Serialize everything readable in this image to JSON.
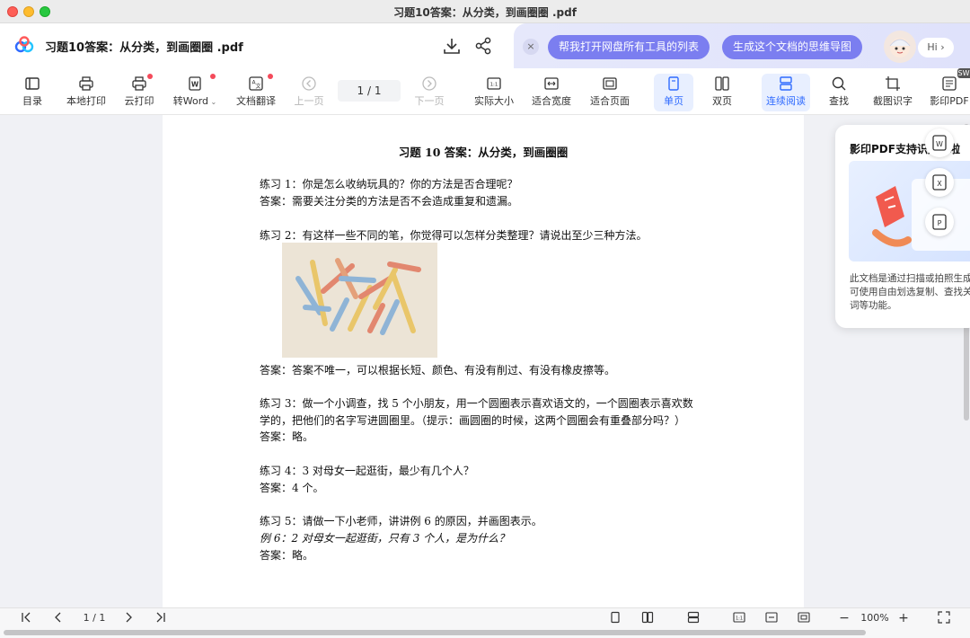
{
  "window": {
    "title": "习题10答案：从分类，到画圈圈 .pdf"
  },
  "header": {
    "doc_title": "习题10答案：从分类，到画圈圈 .pdf",
    "ai_chips": [
      "帮我打开网盘所有工具的列表",
      "生成这个文档的思维导图"
    ],
    "ai_hi": "Hi",
    "close_glyph": "×"
  },
  "toolbar": {
    "items": [
      {
        "label": "目录",
        "icon": "toc-icon"
      },
      {
        "label": "本地打印",
        "icon": "printer-icon"
      },
      {
        "label": "云打印",
        "icon": "cloud-print-icon"
      },
      {
        "label": "转Word",
        "icon": "word-icon"
      },
      {
        "label": "文档翻译",
        "icon": "translate-icon"
      },
      {
        "label": "上一页",
        "icon": "prev-page-icon"
      },
      {
        "label": "下一页",
        "icon": "next-page-icon"
      },
      {
        "label": "实际大小",
        "icon": "actual-size-icon"
      },
      {
        "label": "适合宽度",
        "icon": "fit-width-icon"
      },
      {
        "label": "适合页面",
        "icon": "fit-page-icon"
      },
      {
        "label": "单页",
        "icon": "single-page-icon"
      },
      {
        "label": "双页",
        "icon": "double-page-icon"
      },
      {
        "label": "连续阅读",
        "icon": "continuous-icon"
      },
      {
        "label": "查找",
        "icon": "search-icon"
      },
      {
        "label": "截图识字",
        "icon": "screenshot-ocr-icon"
      },
      {
        "label": "影印PDF",
        "icon": "scan-pdf-icon"
      }
    ],
    "page_indicator": "1 / 1",
    "sw_badge": "SW"
  },
  "document": {
    "title": "习题 10 答案：从分类，到画圈圈",
    "lines": [
      "练习 1：你是怎么收纳玩具的？你的方法是否合理呢？",
      "答案：需要关注分类的方法是否不会造成重复和遗漏。",
      "练习 2：有这样一些不同的笔，你觉得可以怎样分类整理？请说出至少三种方法。",
      "答案：答案不唯一，可以根据长短、颜色、有没有削过、有没有橡皮擦等。",
      "练习 3：做一个小调查，找 5 个小朋友，用一个圆圈表示喜欢语文的，一个圆圈表示喜欢数",
      "学的，把他们的名字写进圆圈里。（提示：画圆圈的时候，这两个圆圈会有重叠部分吗？）",
      "答案：略。",
      "练习 4：3 对母女一起逛街，最少有几个人？",
      "答案：4 个。",
      "练习 5：请做一下小老师，讲讲例 6 的原因，并画图表示。",
      "例 6：2 对母女一起逛街，只有 3 个人，是为什么？",
      "答案：略。"
    ]
  },
  "popup": {
    "title": "影印PDF支持识别字啦",
    "text": "此文档是通过扫描或拍照生成，可使用自由划选复制、查找关键词等功能。",
    "badges": [
      "W",
      "X",
      "P"
    ]
  },
  "bottombar": {
    "page_indicator": "1 / 1",
    "zoom": "100%",
    "minus": "−",
    "plus": "+"
  }
}
